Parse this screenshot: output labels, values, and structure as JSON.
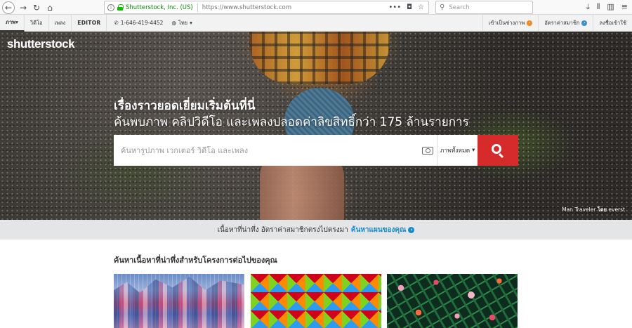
{
  "browser": {
    "org_label": "Shutterstock, Inc. (US)",
    "url": "https://www.shutterstock.com",
    "search_placeholder": "Search",
    "more_icon": "ellipsis-icon",
    "pocket_icon": "pocket-icon",
    "bookmark_icon": "star-icon"
  },
  "sitenav": {
    "images": "ภาพ",
    "videos": "วิดีโอ",
    "music": "เพลง",
    "editor": "EDITOR",
    "phone": "1-646-419-4452",
    "language": "ไทย",
    "contributor": "เข้าเป็นช่างภาพ",
    "pricing": "อัตราค่าสมาชิก",
    "login": "ลงชื่อเข้าใช้"
  },
  "hero": {
    "logo": "shutterstock",
    "headline": "เรื่องราวยอดเยี่ยมเริ่มต้นที่นี่",
    "subline": "ค้นพบภาพ คลิปวิดีโอ และเพลงปลอดค่าลิขสิทธิ์กว่า 175 ล้านรายการ",
    "search_placeholder": "ค้นหารูปภาพ เวกเตอร์ วิดีโอ และเพลง",
    "type_select": "ภาพทั้งหมด",
    "credit_title": "Man Traveler",
    "credit_by": "โดย",
    "credit_author": "everst"
  },
  "promo": {
    "text": "เนื้อหาที่น่าทึ่ง อัตราค่าสมาชิกตรงไปตรงมา",
    "link": "ค้นหาแผนของคุณ"
  },
  "section": {
    "title": "ค้นหาเนื้อหาที่น่าทึ่งสำหรับโครงการต่อไปของคุณ"
  },
  "colors": {
    "accent_red": "#d52b2b",
    "link_blue": "#1a8ac7",
    "secure_green": "#058b00",
    "contributor_orange": "#f08a1c"
  }
}
